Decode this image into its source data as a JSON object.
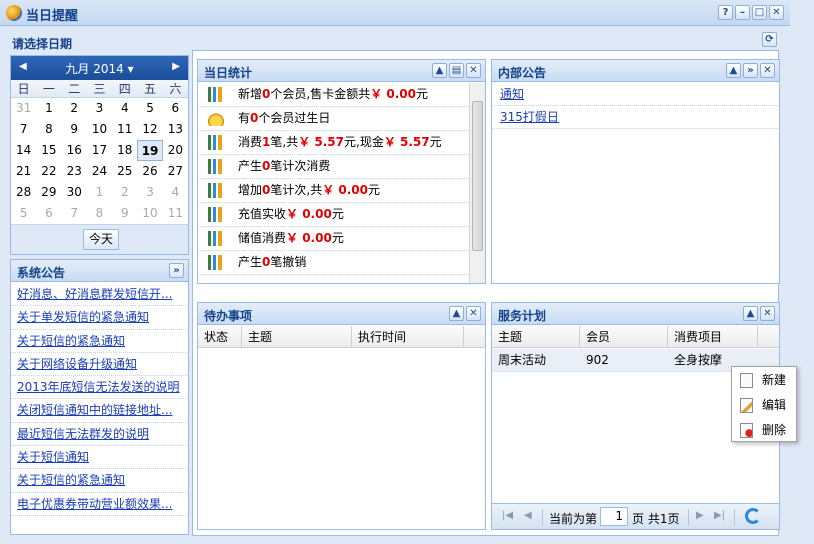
{
  "window": {
    "title": "当日提醒"
  },
  "date_panel": {
    "title": "请选择日期"
  },
  "calendar": {
    "month_label": "九月 2014",
    "weekdays": [
      "日",
      "一",
      "二",
      "三",
      "四",
      "五",
      "六"
    ],
    "days": [
      {
        "v": "31",
        "o": true
      },
      {
        "v": "1"
      },
      {
        "v": "2"
      },
      {
        "v": "3"
      },
      {
        "v": "4"
      },
      {
        "v": "5"
      },
      {
        "v": "6"
      },
      {
        "v": "7"
      },
      {
        "v": "8"
      },
      {
        "v": "9"
      },
      {
        "v": "10"
      },
      {
        "v": "11"
      },
      {
        "v": "12"
      },
      {
        "v": "13"
      },
      {
        "v": "14"
      },
      {
        "v": "15"
      },
      {
        "v": "16"
      },
      {
        "v": "17"
      },
      {
        "v": "18"
      },
      {
        "v": "19",
        "t": true
      },
      {
        "v": "20"
      },
      {
        "v": "21"
      },
      {
        "v": "22"
      },
      {
        "v": "23"
      },
      {
        "v": "24"
      },
      {
        "v": "25"
      },
      {
        "v": "26"
      },
      {
        "v": "27"
      },
      {
        "v": "28"
      },
      {
        "v": "29"
      },
      {
        "v": "30"
      },
      {
        "v": "1",
        "o": true
      },
      {
        "v": "2",
        "o": true
      },
      {
        "v": "3",
        "o": true
      },
      {
        "v": "4",
        "o": true
      },
      {
        "v": "5",
        "o": true
      },
      {
        "v": "6",
        "o": true
      },
      {
        "v": "7",
        "o": true
      },
      {
        "v": "8",
        "o": true
      },
      {
        "v": "9",
        "o": true
      },
      {
        "v": "10",
        "o": true
      },
      {
        "v": "11",
        "o": true
      }
    ],
    "today_button": "今天"
  },
  "system_notice": {
    "title": "系统公告",
    "items": [
      "好消息、好消息群发短信开...",
      "关于单发短信的紧急通知",
      "关于短信的紧急通知",
      "关于网络设备升级通知",
      "2013年底短信无法发送的说明",
      "关闭短信通知中的链接地址...",
      "最近短信无法群发的说明",
      "关于短信通知",
      "关于短信的紧急通知",
      "电子优惠券带动营业额效果..."
    ]
  },
  "daily_stats": {
    "title": "当日统计",
    "rows": [
      {
        "icon": "bar-chart-icon",
        "parts": [
          {
            "t": "新增"
          },
          {
            "t": "0",
            "r": true
          },
          {
            "t": "个会员,售卡金额共"
          },
          {
            "t": "￥ 0.00",
            "r": true
          },
          {
            "t": "元"
          }
        ]
      },
      {
        "icon": "crown-icon",
        "parts": [
          {
            "t": "有"
          },
          {
            "t": "0",
            "r": true
          },
          {
            "t": "个会员过生日"
          }
        ]
      },
      {
        "icon": "bar-chart-icon",
        "parts": [
          {
            "t": "消费"
          },
          {
            "t": "1",
            "r": true
          },
          {
            "t": "笔,共"
          },
          {
            "t": "￥ 5.57",
            "r": true
          },
          {
            "t": "元,现金"
          },
          {
            "t": "￥ 5.57",
            "r": true
          },
          {
            "t": "元"
          }
        ]
      },
      {
        "icon": "bar-chart-icon",
        "parts": [
          {
            "t": "产生"
          },
          {
            "t": "0",
            "r": true
          },
          {
            "t": "笔计次消费"
          }
        ]
      },
      {
        "icon": "bar-chart-icon",
        "parts": [
          {
            "t": "增加"
          },
          {
            "t": "0",
            "r": true
          },
          {
            "t": "笔计次,共"
          },
          {
            "t": "￥ 0.00",
            "r": true
          },
          {
            "t": "元"
          }
        ]
      },
      {
        "icon": "bar-chart-icon",
        "parts": [
          {
            "t": "充值实收"
          },
          {
            "t": "￥ 0.00",
            "r": true
          },
          {
            "t": "元"
          }
        ]
      },
      {
        "icon": "bar-chart-icon",
        "parts": [
          {
            "t": "储值消费"
          },
          {
            "t": "￥ 0.00",
            "r": true
          },
          {
            "t": "元"
          }
        ]
      },
      {
        "icon": "bar-chart-icon",
        "parts": [
          {
            "t": "产生"
          },
          {
            "t": "0",
            "r": true
          },
          {
            "t": "笔撤销"
          }
        ]
      }
    ]
  },
  "internal_notice": {
    "title": "内部公告",
    "items": [
      "通知",
      "315打假日"
    ]
  },
  "todo": {
    "title": "待办事项",
    "columns": [
      "状态",
      "主题",
      "执行时间"
    ]
  },
  "service_plan": {
    "title": "服务计划",
    "columns": [
      "主题",
      "会员",
      "消费项目"
    ],
    "rows": [
      [
        "周末活动",
        "902",
        "全身按摩"
      ]
    ],
    "pager": {
      "before": "当前为第",
      "page": "1",
      "after": "页 共1页"
    }
  },
  "context_menu": {
    "new": "新建",
    "edit": "编辑",
    "delete": "删除"
  }
}
